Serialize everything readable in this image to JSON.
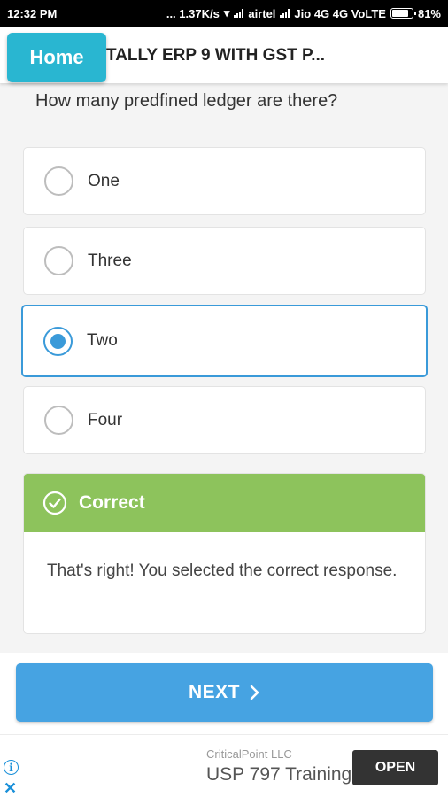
{
  "status_bar": {
    "time": "12:32 PM",
    "network_speed": "... 1.37K/s",
    "carrier1": "airtel",
    "carrier2": "Jio 4G 4G VoLTE",
    "battery_percent": "81%",
    "battery_level": 0.81
  },
  "header": {
    "home_label": "Home",
    "title": "TALLY ERP 9 WITH GST P..."
  },
  "question": "How many predfined ledger are there?",
  "options": [
    {
      "label": "One",
      "selected": false
    },
    {
      "label": "Three",
      "selected": false
    },
    {
      "label": "Two",
      "selected": true
    },
    {
      "label": "Four",
      "selected": false
    }
  ],
  "feedback": {
    "title": "Correct",
    "message": "That's right! You selected the correct response.",
    "icon": "check-circle-icon",
    "color": "#8dc35c"
  },
  "next_button": {
    "label": "NEXT",
    "icon": "chevron-right-icon",
    "color": "#46a3e2"
  },
  "ad": {
    "company": "CriticalPoint LLC",
    "headline": "USP 797 Training",
    "cta": "OPEN"
  },
  "colors": {
    "accent": "#3a9ad9",
    "home": "#29b6d1"
  }
}
